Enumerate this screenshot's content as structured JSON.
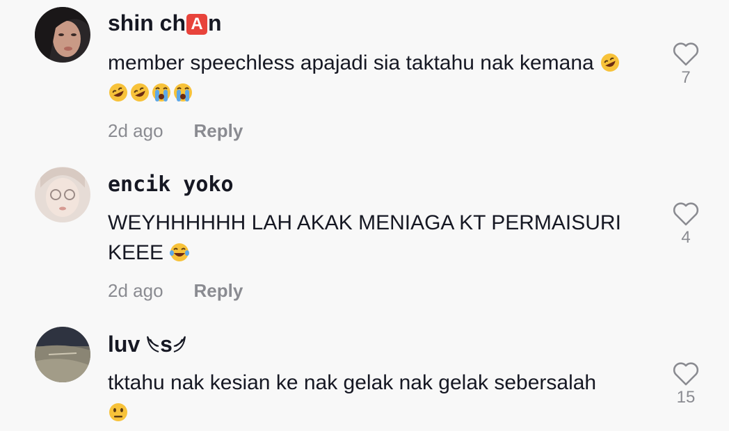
{
  "comments": [
    {
      "username_prefix": "shin ch",
      "username_badge": "A",
      "username_suffix": "n",
      "text": "member speechless apajadi sia taktahu nak kemana",
      "time": "2d ago",
      "reply_label": "Reply",
      "likes": "7"
    },
    {
      "username": "encik yoko",
      "text": "WEYHHHHHH LAH AKAK MENIAGA KT PERMAISURI KEEE",
      "time": "2d ago",
      "reply_label": "Reply",
      "likes": "4"
    },
    {
      "username_prefix": "luv",
      "username_middle": "s",
      "text": "tktahu nak kesian ke nak gelak nak gelak sebersalah",
      "likes": "15"
    }
  ],
  "colors": {
    "background": "#f8f8f8",
    "text_primary": "#161823",
    "text_secondary": "#8a8b91",
    "badge_red": "#e8433b"
  },
  "icons": {
    "like": "heart-outline-icon",
    "emoji_laugh_roll": "rolling-on-floor-laughing-emoji",
    "emoji_cry": "loudly-crying-emoji",
    "emoji_joy": "tears-of-joy-emoji",
    "emoji_neutral": "neutral-face-emoji"
  }
}
